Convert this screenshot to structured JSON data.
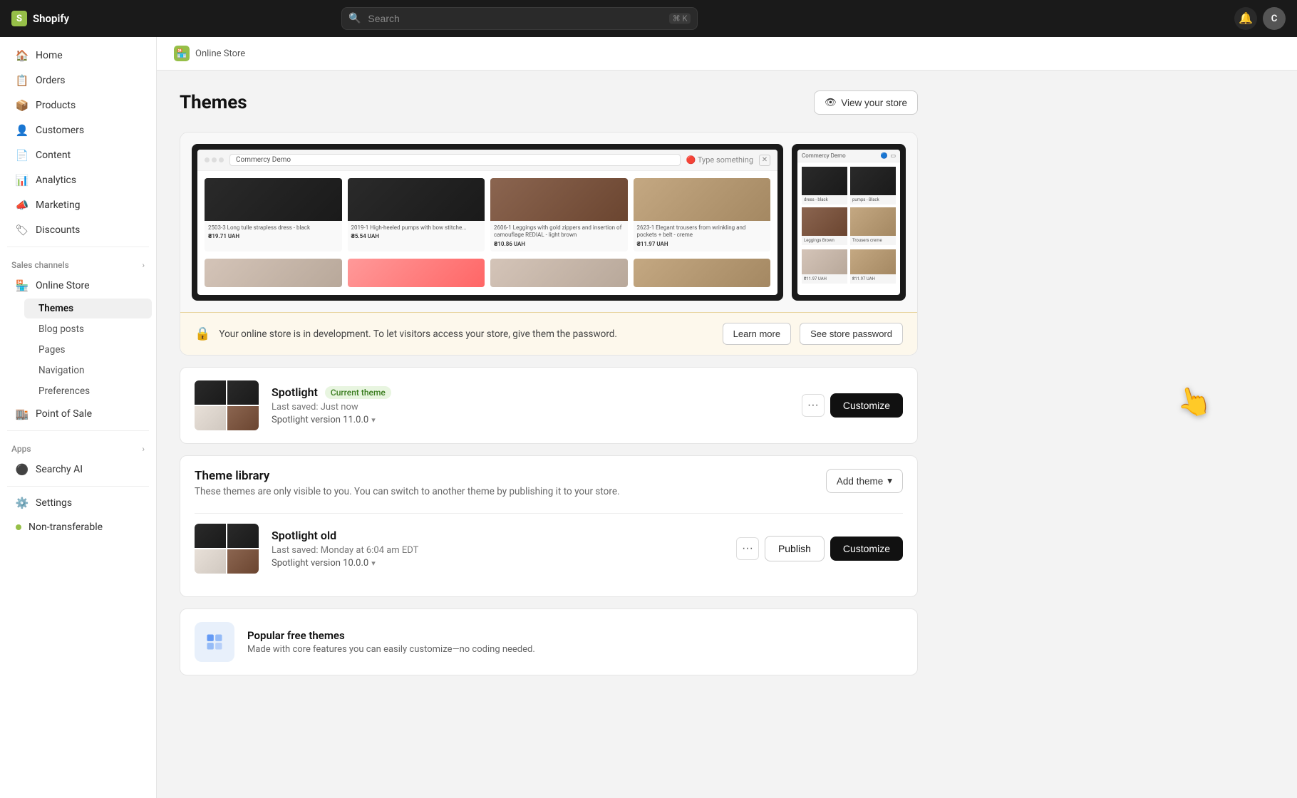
{
  "app": {
    "name": "Shopify",
    "logo_text": "shopify"
  },
  "topbar": {
    "search_placeholder": "Search",
    "search_shortcut": "⌘ K"
  },
  "sidebar": {
    "main_items": [
      {
        "id": "home",
        "label": "Home",
        "icon": "🏠"
      },
      {
        "id": "orders",
        "label": "Orders",
        "icon": "📋"
      },
      {
        "id": "products",
        "label": "Products",
        "icon": "📦"
      },
      {
        "id": "customers",
        "label": "Customers",
        "icon": "👤"
      },
      {
        "id": "content",
        "label": "Content",
        "icon": "📄"
      },
      {
        "id": "analytics",
        "label": "Analytics",
        "icon": "📊"
      },
      {
        "id": "marketing",
        "label": "Marketing",
        "icon": "📣"
      },
      {
        "id": "discounts",
        "label": "Discounts",
        "icon": "🏷"
      }
    ],
    "sales_channels_title": "Sales channels",
    "online_store_label": "Online Store",
    "themes_label": "Themes",
    "blog_posts_label": "Blog posts",
    "pages_label": "Pages",
    "navigation_label": "Navigation",
    "preferences_label": "Preferences",
    "point_of_sale_label": "Point of Sale",
    "apps_title": "Apps",
    "searchy_ai_label": "Searchy AI",
    "settings_label": "Settings",
    "non_transferable_label": "Non-transferable"
  },
  "breadcrumb": {
    "icon": "🏪",
    "label": "Online Store"
  },
  "page": {
    "title": "Themes",
    "view_store_label": "View your store"
  },
  "password_banner": {
    "icon": "🔒",
    "text": "Your online store is in development. To let visitors access your store, give them the password.",
    "learn_more": "Learn more",
    "see_password": "See store password"
  },
  "current_theme": {
    "name": "Spotlight",
    "badge": "Current theme",
    "last_saved": "Last saved: Just now",
    "version": "Spotlight version 11.0.0",
    "more_label": "···",
    "customize_label": "Customize"
  },
  "theme_library": {
    "title": "Theme library",
    "description": "These themes are only visible to you. You can switch to another theme by publishing it to your store.",
    "add_theme_label": "Add theme",
    "themes": [
      {
        "name": "Spotlight old",
        "last_saved": "Last saved: Monday at 6:04 am EDT",
        "version": "Spotlight version 10.0.0",
        "publish_label": "Publish",
        "customize_label": "Customize",
        "more_label": "···"
      }
    ]
  },
  "popular_free": {
    "title": "Popular free themes",
    "description": "Made with core features you can easily customize—no coding needed."
  },
  "cursor": {
    "right": "1255",
    "top": "580"
  }
}
